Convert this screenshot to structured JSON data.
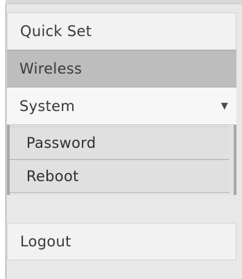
{
  "menu": {
    "quick_set": "Quick Set",
    "wireless": "Wireless",
    "system": "System",
    "system_chevron": "▼",
    "submenu": {
      "password": "Password",
      "reboot": "Reboot"
    },
    "logout": "Logout"
  },
  "colors": {
    "panel_bg": "#e8e8e8",
    "selected_bg": "#bdbdbd",
    "item_bg": "#f2f2f2",
    "submenu_bg": "#e0e0e0",
    "text": "#3a3a3a"
  },
  "icons": {
    "system_expand": "chevron-down-icon"
  }
}
